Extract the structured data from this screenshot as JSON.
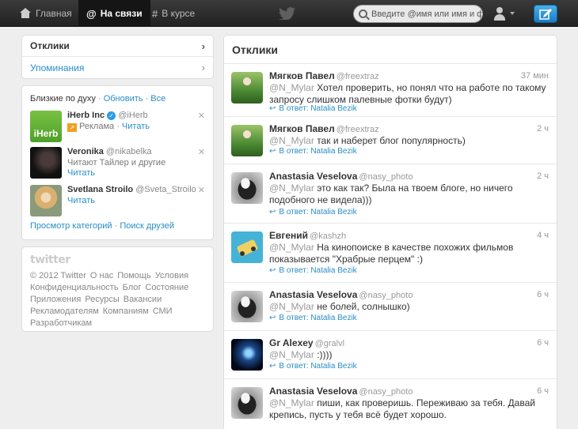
{
  "topbar": {
    "home_label": "Главная",
    "connect_label": "На связи",
    "discover_label": "В курсе",
    "search_placeholder": "Введите @имя или имя и фа"
  },
  "sidebar": {
    "tabs": [
      {
        "label": "Отклики"
      },
      {
        "label": "Упоминания"
      }
    ]
  },
  "wtf": {
    "title": "Близкие по духу",
    "refresh": "Обновить",
    "all": "Все",
    "suggestions": [
      {
        "name": "iHerb Inc",
        "handle": "@iHerb",
        "sub": "Реклама",
        "follow": "Читать",
        "thumb_text": "iHerb"
      },
      {
        "name": "Veronika",
        "handle": "@nikabelka",
        "sub": "Читают Тайлер и другие",
        "follow": "Читать"
      },
      {
        "name": "Svetlana Stroilo",
        "handle": "@Sveta_Stroilo",
        "sub": "",
        "follow": "Читать"
      }
    ],
    "browse_categories": "Просмотр категорий",
    "find_friends": "Поиск друзей"
  },
  "footer": {
    "logo": "twitter",
    "links": [
      "© 2012 Twitter",
      "О нас",
      "Помощь",
      "Условия",
      "Конфиденциальность",
      "Блог",
      "Состояние",
      "Приложения",
      "Ресурсы",
      "Вакансии",
      "Рекламодателям",
      "Компаниям",
      "СМИ",
      "Разработчикам"
    ]
  },
  "stream": {
    "title": "Отклики",
    "tweets": [
      {
        "name": "Мягков Павел",
        "handle": "@freextraz",
        "time": "37 мин",
        "mention": "@N_Mylar",
        "text": " Хотел проверить, но понял что на работе по такому запросу слишком палевные фотки будут)",
        "reply": "В ответ: Natalia Bezik"
      },
      {
        "name": "Мягков Павел",
        "handle": "@freextraz",
        "time": "2 ч",
        "mention": "@N_Mylar",
        "text": " так и наберет блог популярность)",
        "reply": "В ответ: Natalia Bezik"
      },
      {
        "name": "Anastasia Veselova",
        "handle": "@nasy_photo",
        "time": "2 ч",
        "mention": "@N_Mylar",
        "text": " это как так? Была на твоем блоге, но ничего подобного не видела)))",
        "reply": "В ответ: Natalia Bezik"
      },
      {
        "name": "Евгений",
        "handle": "@kashzh",
        "time": "4 ч",
        "mention": "@N_Mylar",
        "text": " На кинопоиске в качестве похожих фильмов показывается \"Храбрые перцем\" :)",
        "reply": "В ответ: Natalia Bezik"
      },
      {
        "name": "Anastasia Veselova",
        "handle": "@nasy_photo",
        "time": "6 ч",
        "mention": "@N_Mylar",
        "text": " не болей, солнышко)",
        "reply": "В ответ: Natalia Bezik"
      },
      {
        "name": "Gr Alexey",
        "handle": "@gralvl",
        "time": "6 ч",
        "mention": "@N_Mylar",
        "text": " :))))",
        "reply": "В ответ: Natalia Bezik"
      },
      {
        "name": "Anastasia Veselova",
        "handle": "@nasy_photo",
        "time": "6 ч",
        "mention": "@N_Mylar",
        "text": " пиши, как проверишь. Переживаю за тебя. Давай крепись, пусть у тебя всё будет хорошо.",
        "reply": ""
      }
    ]
  },
  "colors": {
    "link": "#2a8ec5",
    "topbar": "#222222",
    "compose": "#1a7dc4"
  }
}
